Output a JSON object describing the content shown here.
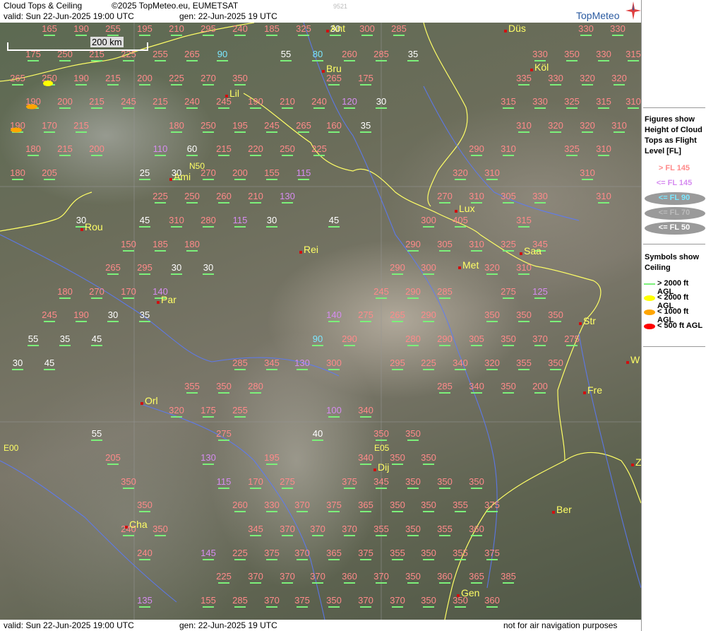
{
  "header": {
    "title": "Cloud Tops & Ceiling",
    "copyright": "©2025 TopMeteo.eu, EUMETSAT",
    "valid": "valid:  Sun  22-Jun-2025  19:00 UTC",
    "gen": "gen: 22-Jun-2025 19 UTC",
    "code": "9521",
    "brand": "TopMeteo"
  },
  "footer": {
    "valid": "valid:  Sun  22-Jun-2025  19:00 UTC",
    "gen": "gen: 22-Jun-2025 19 UTC",
    "disclaimer": "not for air navigation purposes"
  },
  "scale": {
    "label": "200 km"
  },
  "legend": {
    "heights_title": "Figures show Height of Cloud Tops as Flight Level [FL]",
    "heights": [
      {
        "label": "> FL 145",
        "color": "#ff8a8a"
      },
      {
        "label": "<= FL 145",
        "color": "#d68cf0"
      },
      {
        "label": "<= FL 90",
        "color": "#7be7ff"
      },
      {
        "label": "<= FL 70",
        "color": "#bbbbbb"
      },
      {
        "label": "<= FL 50",
        "color": "#ffffff"
      }
    ],
    "ceiling_title": "Symbols show Ceiling",
    "ceiling": [
      {
        "label": "> 2000 ft AGL",
        "color": "#7cf07a"
      },
      {
        "label": "< 2000 ft AGL",
        "color": "#ffff00"
      },
      {
        "label": "< 1000 ft AGL",
        "color": "#ffa500"
      },
      {
        "label": "< 500 ft AGL",
        "color": "#ff0000"
      }
    ]
  },
  "cities": [
    {
      "name": "Ant"
    },
    {
      "name": "Düs"
    },
    {
      "name": "Bru"
    },
    {
      "name": "Köl"
    },
    {
      "name": "Lil"
    },
    {
      "name": "Ami"
    },
    {
      "name": "Lux"
    },
    {
      "name": "Rou"
    },
    {
      "name": "Rei"
    },
    {
      "name": "Saa"
    },
    {
      "name": "Met"
    },
    {
      "name": "Par"
    },
    {
      "name": "Str"
    },
    {
      "name": "W"
    },
    {
      "name": "Fre"
    },
    {
      "name": "Orl"
    },
    {
      "name": "Dij"
    },
    {
      "name": "Ber"
    },
    {
      "name": "Cha"
    },
    {
      "name": "Gen"
    },
    {
      "name": "Z"
    }
  ],
  "coords": [
    "N50",
    "E00",
    "E05"
  ],
  "fl_values": [
    [
      "165",
      "p"
    ],
    [
      "190",
      "p"
    ],
    [
      "255",
      "p"
    ],
    [
      "195",
      "p"
    ],
    [
      "210",
      "p"
    ],
    [
      "295",
      "p"
    ],
    [
      "240",
      "p"
    ],
    [
      "185",
      "p"
    ],
    [
      "325",
      "p"
    ],
    [
      "30",
      "w"
    ],
    [
      "300",
      "p"
    ],
    [
      "285",
      "p"
    ],
    [
      "330",
      "p"
    ],
    [
      "330",
      "p"
    ],
    [
      "175",
      "p"
    ],
    [
      "250",
      "p"
    ],
    [
      "215",
      "p"
    ],
    [
      "225",
      "p"
    ],
    [
      "255",
      "p"
    ],
    [
      "265",
      "p"
    ],
    [
      "90",
      "c"
    ],
    [
      "55",
      "w"
    ],
    [
      "80",
      "c"
    ],
    [
      "260",
      "p"
    ],
    [
      "285",
      "p"
    ],
    [
      "35",
      "w"
    ],
    [
      "330",
      "p"
    ],
    [
      "350",
      "p"
    ],
    [
      "330",
      "p"
    ],
    [
      "315",
      "p"
    ],
    [
      "265",
      "p"
    ],
    [
      "250",
      "p"
    ],
    [
      "190",
      "p"
    ],
    [
      "215",
      "p"
    ],
    [
      "200",
      "p"
    ],
    [
      "225",
      "p"
    ],
    [
      "270",
      "p"
    ],
    [
      "350",
      "p"
    ],
    [
      "265",
      "p"
    ],
    [
      "175",
      "p"
    ],
    [
      "335",
      "p"
    ],
    [
      "330",
      "p"
    ],
    [
      "320",
      "p"
    ],
    [
      "320",
      "p"
    ],
    [
      "190",
      "p"
    ],
    [
      "200",
      "p"
    ],
    [
      "215",
      "p"
    ],
    [
      "245",
      "p"
    ],
    [
      "215",
      "p"
    ],
    [
      "240",
      "p"
    ],
    [
      "245",
      "p"
    ],
    [
      "190",
      "p"
    ],
    [
      "210",
      "p"
    ],
    [
      "240",
      "p"
    ],
    [
      "120",
      "v"
    ],
    [
      "30",
      "w"
    ],
    [
      "315",
      "p"
    ],
    [
      "330",
      "p"
    ],
    [
      "325",
      "p"
    ],
    [
      "315",
      "p"
    ],
    [
      "310",
      "p"
    ],
    [
      "190",
      "p"
    ],
    [
      "170",
      "p"
    ],
    [
      "215",
      "p"
    ],
    [
      "180",
      "p"
    ],
    [
      "250",
      "p"
    ],
    [
      "195",
      "p"
    ],
    [
      "245",
      "p"
    ],
    [
      "265",
      "p"
    ],
    [
      "160",
      "p"
    ],
    [
      "35",
      "w"
    ],
    [
      "310",
      "p"
    ],
    [
      "320",
      "p"
    ],
    [
      "320",
      "p"
    ],
    [
      "310",
      "p"
    ],
    [
      "180",
      "p"
    ],
    [
      "215",
      "p"
    ],
    [
      "200",
      "p"
    ],
    [
      "110",
      "v"
    ],
    [
      "60",
      "w"
    ],
    [
      "215",
      "p"
    ],
    [
      "220",
      "p"
    ],
    [
      "250",
      "p"
    ],
    [
      "225",
      "p"
    ],
    [
      "290",
      "p"
    ],
    [
      "310",
      "p"
    ],
    [
      "325",
      "p"
    ],
    [
      "310",
      "p"
    ],
    [
      "180",
      "p"
    ],
    [
      "205",
      "p"
    ],
    [
      "25",
      "w"
    ],
    [
      "30",
      "w"
    ],
    [
      "270",
      "p"
    ],
    [
      "200",
      "p"
    ],
    [
      "155",
      "p"
    ],
    [
      "115",
      "v"
    ],
    [
      "320",
      "p"
    ],
    [
      "310",
      "p"
    ],
    [
      "310",
      "p"
    ],
    [
      "225",
      "p"
    ],
    [
      "250",
      "p"
    ],
    [
      "260",
      "p"
    ],
    [
      "210",
      "p"
    ],
    [
      "130",
      "v"
    ],
    [
      "270",
      "p"
    ],
    [
      "310",
      "p"
    ],
    [
      "305",
      "p"
    ],
    [
      "330",
      "p"
    ],
    [
      "310",
      "p"
    ],
    [
      "30",
      "w"
    ],
    [
      "45",
      "w"
    ],
    [
      "310",
      "p"
    ],
    [
      "280",
      "p"
    ],
    [
      "115",
      "v"
    ],
    [
      "30",
      "w"
    ],
    [
      "45",
      "w"
    ],
    [
      "300",
      "p"
    ],
    [
      "405",
      "p"
    ],
    [
      "315",
      "p"
    ],
    [
      "150",
      "p"
    ],
    [
      "185",
      "p"
    ],
    [
      "180",
      "p"
    ],
    [
      "290",
      "p"
    ],
    [
      "305",
      "p"
    ],
    [
      "310",
      "p"
    ],
    [
      "325",
      "p"
    ],
    [
      "345",
      "p"
    ],
    [
      "265",
      "p"
    ],
    [
      "295",
      "p"
    ],
    [
      "30",
      "w"
    ],
    [
      "30",
      "w"
    ],
    [
      "290",
      "p"
    ],
    [
      "300",
      "p"
    ],
    [
      "320",
      "p"
    ],
    [
      "310",
      "p"
    ],
    [
      "180",
      "p"
    ],
    [
      "270",
      "p"
    ],
    [
      "170",
      "p"
    ],
    [
      "140",
      "v"
    ],
    [
      "245",
      "p"
    ],
    [
      "290",
      "p"
    ],
    [
      "285",
      "p"
    ],
    [
      "275",
      "p"
    ],
    [
      "125",
      "v"
    ],
    [
      "245",
      "p"
    ],
    [
      "190",
      "p"
    ],
    [
      "30",
      "w"
    ],
    [
      "35",
      "w"
    ],
    [
      "140",
      "v"
    ],
    [
      "275",
      "p"
    ],
    [
      "265",
      "p"
    ],
    [
      "290",
      "p"
    ],
    [
      "350",
      "p"
    ],
    [
      "350",
      "p"
    ],
    [
      "350",
      "p"
    ],
    [
      "55",
      "w"
    ],
    [
      "35",
      "w"
    ],
    [
      "45",
      "w"
    ],
    [
      "90",
      "c"
    ],
    [
      "290",
      "p"
    ],
    [
      "280",
      "p"
    ],
    [
      "290",
      "p"
    ],
    [
      "305",
      "p"
    ],
    [
      "350",
      "p"
    ],
    [
      "370",
      "p"
    ],
    [
      "275",
      "p"
    ],
    [
      "30",
      "w"
    ],
    [
      "45",
      "w"
    ],
    [
      "285",
      "p"
    ],
    [
      "345",
      "p"
    ],
    [
      "130",
      "v"
    ],
    [
      "300",
      "p"
    ],
    [
      "295",
      "p"
    ],
    [
      "225",
      "p"
    ],
    [
      "340",
      "p"
    ],
    [
      "320",
      "p"
    ],
    [
      "355",
      "p"
    ],
    [
      "350",
      "p"
    ],
    [
      "355",
      "p"
    ],
    [
      "350",
      "p"
    ],
    [
      "280",
      "p"
    ],
    [
      "285",
      "p"
    ],
    [
      "340",
      "p"
    ],
    [
      "350",
      "p"
    ],
    [
      "200",
      "p"
    ],
    [
      "320",
      "p"
    ],
    [
      "175",
      "p"
    ],
    [
      "255",
      "p"
    ],
    [
      "100",
      "v"
    ],
    [
      "340",
      "p"
    ],
    [
      "55",
      "w"
    ],
    [
      "275",
      "p"
    ],
    [
      "40",
      "w"
    ],
    [
      "350",
      "p"
    ],
    [
      "350",
      "p"
    ],
    [
      "205",
      "p"
    ],
    [
      "130",
      "v"
    ],
    [
      "195",
      "p"
    ],
    [
      "340",
      "p"
    ],
    [
      "350",
      "p"
    ],
    [
      "350",
      "p"
    ],
    [
      "350",
      "p"
    ],
    [
      "115",
      "v"
    ],
    [
      "170",
      "p"
    ],
    [
      "275",
      "p"
    ],
    [
      "375",
      "p"
    ],
    [
      "345",
      "p"
    ],
    [
      "350",
      "p"
    ],
    [
      "350",
      "p"
    ],
    [
      "350",
      "p"
    ],
    [
      "350",
      "p"
    ],
    [
      "260",
      "p"
    ],
    [
      "330",
      "p"
    ],
    [
      "370",
      "p"
    ],
    [
      "375",
      "p"
    ],
    [
      "365",
      "p"
    ],
    [
      "350",
      "p"
    ],
    [
      "350",
      "p"
    ],
    [
      "355",
      "p"
    ],
    [
      "375",
      "p"
    ],
    [
      "240",
      "p"
    ],
    [
      "350",
      "p"
    ],
    [
      "345",
      "p"
    ],
    [
      "370",
      "p"
    ],
    [
      "370",
      "p"
    ],
    [
      "370",
      "p"
    ],
    [
      "355",
      "p"
    ],
    [
      "350",
      "p"
    ],
    [
      "355",
      "p"
    ],
    [
      "360",
      "p"
    ],
    [
      "240",
      "p"
    ],
    [
      "145",
      "v"
    ],
    [
      "225",
      "p"
    ],
    [
      "375",
      "p"
    ],
    [
      "370",
      "p"
    ],
    [
      "365",
      "p"
    ],
    [
      "375",
      "p"
    ],
    [
      "355",
      "p"
    ],
    [
      "350",
      "p"
    ],
    [
      "355",
      "p"
    ],
    [
      "375",
      "p"
    ],
    [
      "225",
      "p"
    ],
    [
      "370",
      "p"
    ],
    [
      "370",
      "p"
    ],
    [
      "370",
      "p"
    ],
    [
      "360",
      "p"
    ],
    [
      "370",
      "p"
    ],
    [
      "350",
      "p"
    ],
    [
      "360",
      "p"
    ],
    [
      "365",
      "p"
    ],
    [
      "385",
      "p"
    ],
    [
      "135",
      "v"
    ],
    [
      "155",
      "p"
    ],
    [
      "285",
      "p"
    ],
    [
      "370",
      "p"
    ],
    [
      "375",
      "p"
    ],
    [
      "350",
      "p"
    ],
    [
      "370",
      "p"
    ],
    [
      "370",
      "p"
    ],
    [
      "350",
      "p"
    ],
    [
      "350",
      "p"
    ],
    [
      "360",
      "p"
    ]
  ]
}
